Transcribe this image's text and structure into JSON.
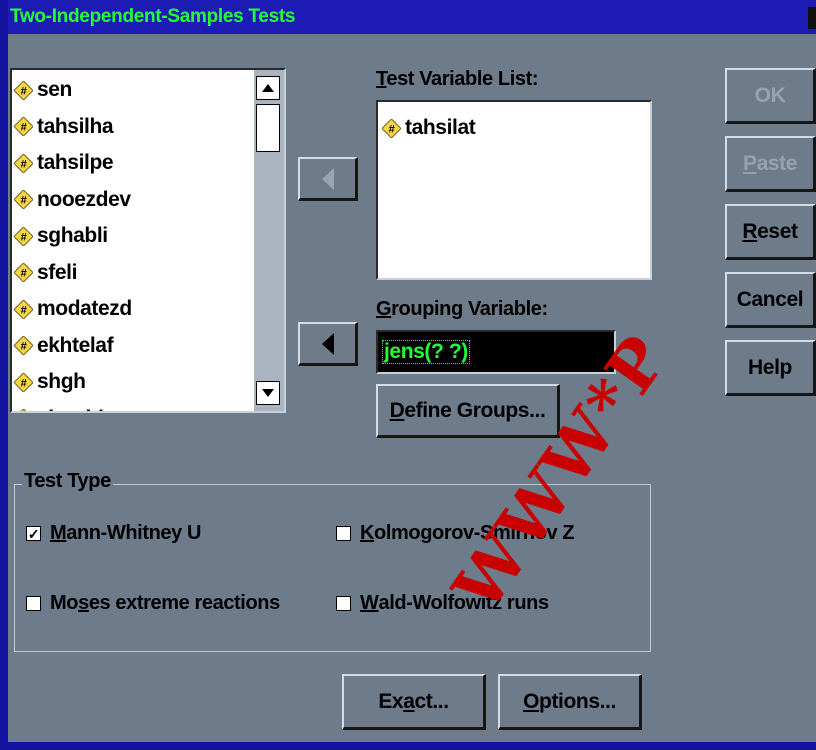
{
  "window": {
    "title": "Two-Independent-Samples Tests",
    "title_color": "#22ff33",
    "titlebar_color": "#1c1cb4",
    "face_color": "#6e7b8b"
  },
  "source_list": {
    "items": [
      "sen",
      "tahsilha",
      "tahsilpe",
      "nooezdev",
      "sghabli",
      "sfeli",
      "modatezd",
      "ekhtelaf",
      "shgh",
      "shoghl"
    ],
    "item_icon": "numeric-variable-icon"
  },
  "test_variable": {
    "label_underlined": "T",
    "label_rest": "est Variable List:",
    "items": [
      "tahsilat"
    ]
  },
  "grouping_variable": {
    "label_underlined": "G",
    "label_rest": "rouping Variable:",
    "value": "jens(? ?)"
  },
  "buttons": {
    "move_test": "◀",
    "move_group": "◀",
    "define_groups_u": "D",
    "define_groups_rest": "efine Groups...",
    "ok": "OK",
    "paste_u": "P",
    "paste_rest": "aste",
    "reset_u": "R",
    "reset_rest": "eset",
    "cancel": "Cancel",
    "help": "Help",
    "exact_pre": "Ex",
    "exact_u": "a",
    "exact_rest": "ct...",
    "options_u": "O",
    "options_rest": "ptions..."
  },
  "test_type": {
    "title": "Test Type",
    "mann_whitney": {
      "checked": true,
      "u": "M",
      "rest": "ann-Whitney U"
    },
    "kolmogorov": {
      "checked": false,
      "u": "K",
      "rest": "olmogorov-Smirnov Z"
    },
    "moses": {
      "checked": false,
      "pre": "Mo",
      "u": "s",
      "rest": "es extreme reactions"
    },
    "wald": {
      "checked": false,
      "u": "W",
      "rest": "ald-Wolfowitz runs"
    }
  },
  "watermark": "WWW*P"
}
